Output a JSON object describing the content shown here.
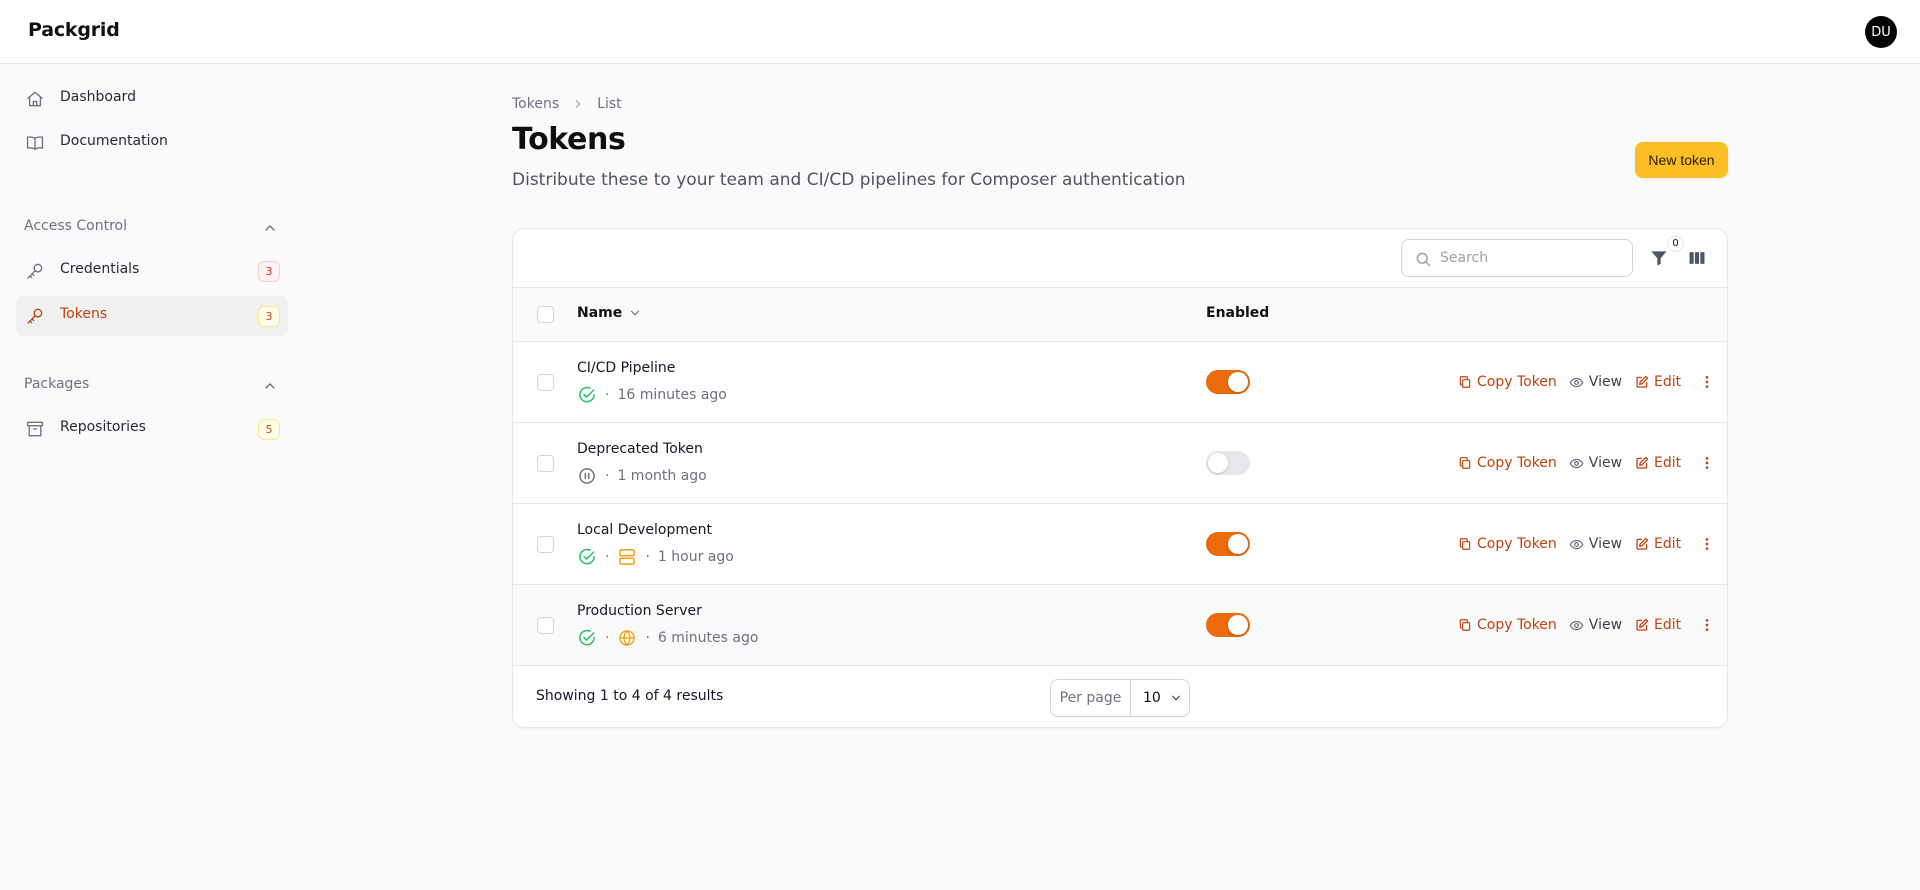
{
  "app": {
    "brand": "Packgrid",
    "user_initials": "DU"
  },
  "sidebar": {
    "nav": [
      {
        "label": "Dashboard",
        "icon": "home-icon"
      },
      {
        "label": "Documentation",
        "icon": "book-icon"
      }
    ],
    "groups": [
      {
        "title": "Access Control",
        "items": [
          {
            "label": "Credentials",
            "badge": "3",
            "icon": "key-icon"
          },
          {
            "label": "Tokens",
            "badge": "3",
            "icon": "key-icon"
          }
        ]
      },
      {
        "title": "Packages",
        "items": [
          {
            "label": "Repositories",
            "badge": "5",
            "icon": "archive-icon"
          }
        ]
      }
    ]
  },
  "breadcrumb": [
    "Tokens",
    "List"
  ],
  "page": {
    "title": "Tokens",
    "subtitle": "Distribute these to your team and CI/CD pipelines for Composer authentication",
    "new_button": "New token"
  },
  "table": {
    "search_placeholder": "Search",
    "filter_count": "0",
    "columns": {
      "name": "Name",
      "enabled": "Enabled"
    },
    "rows": [
      {
        "name": "CI/CD Pipeline",
        "status": "active",
        "scope": "",
        "time": "16 minutes ago",
        "enabled": true
      },
      {
        "name": "Deprecated Token",
        "status": "paused",
        "scope": "",
        "time": "1 month ago",
        "enabled": false
      },
      {
        "name": "Local Development",
        "status": "active",
        "scope": "server",
        "time": "1 hour ago",
        "enabled": true
      },
      {
        "name": "Production Server",
        "status": "active",
        "scope": "globe",
        "time": "6 minutes ago",
        "enabled": true
      }
    ],
    "actions": {
      "copy": "Copy Token",
      "view": "View",
      "edit": "Edit"
    },
    "footer": {
      "showing": "Showing 1 to 4 of 4 results",
      "per_page_label": "Per page",
      "per_page_value": "10"
    }
  },
  "colors": {
    "accent": "#ea6a0c",
    "accent_text": "#c2410c",
    "primary_button": "#fbbf24",
    "success": "#22c55e"
  }
}
